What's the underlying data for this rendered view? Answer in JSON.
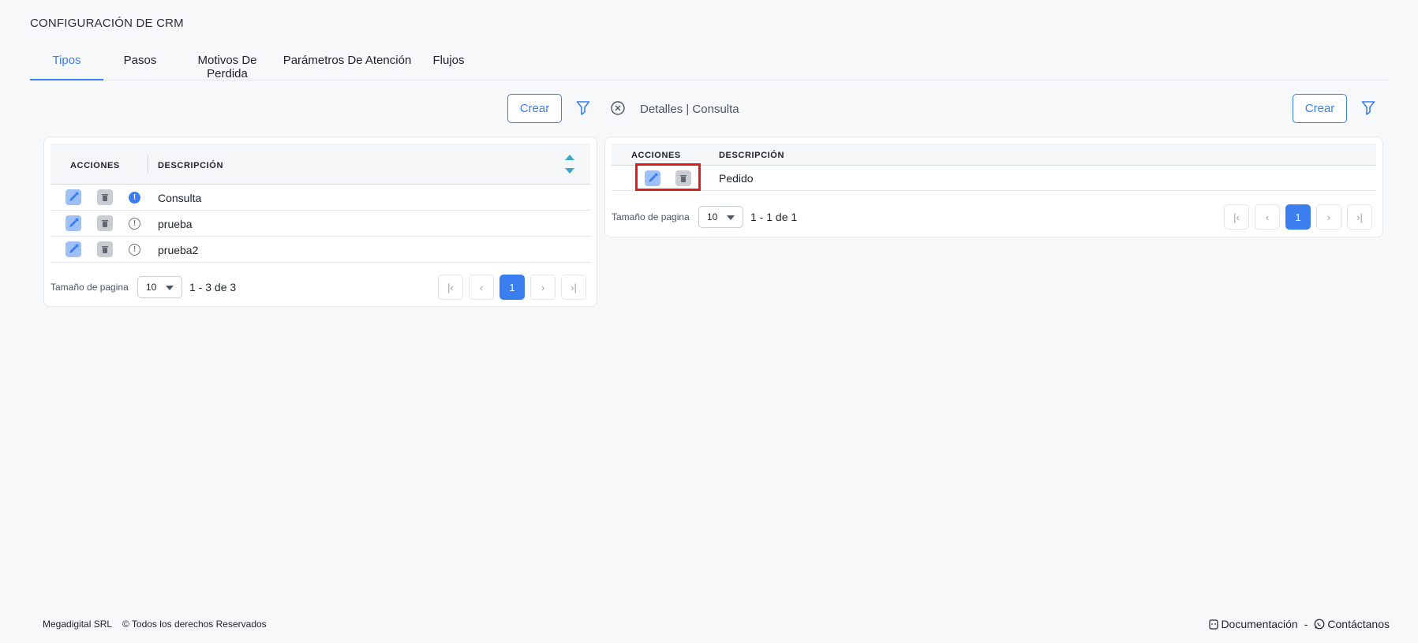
{
  "page": {
    "title": "CONFIGURACIÓN DE CRM"
  },
  "tabs": [
    {
      "label": "Tipos",
      "active": true
    },
    {
      "label": "Pasos",
      "active": false
    },
    {
      "label": "Motivos De Perdida",
      "active": false
    },
    {
      "label": "Parámetros De Atención",
      "active": false
    },
    {
      "label": "Flujos",
      "active": false
    }
  ],
  "left_panel": {
    "create_label": "Crear",
    "headers": {
      "actions": "ACCIONES",
      "description": "DESCRIPCIÓN"
    },
    "rows": [
      {
        "description": "Consulta",
        "selected": true
      },
      {
        "description": "prueba",
        "selected": false
      },
      {
        "description": "prueba2",
        "selected": false
      }
    ],
    "pagination": {
      "size_label": "Tamaño de pagina",
      "page_size": "10",
      "range": "1 - 3 de 3",
      "current_page": "1"
    }
  },
  "right_panel": {
    "details_label": "Detalles | Consulta",
    "create_label": "Crear",
    "headers": {
      "actions": "ACCIONES",
      "description": "DESCRIPCIÓN"
    },
    "rows": [
      {
        "description": "Pedido"
      }
    ],
    "pagination": {
      "size_label": "Tamaño de pagina",
      "page_size": "10",
      "range": "1 - 1 de 1",
      "current_page": "1"
    }
  },
  "footer": {
    "company": "Megadigital SRL",
    "rights": "© Todos los derechos Reservados",
    "documentation": "Documentación",
    "separator": "-",
    "contact": "Contáctanos"
  },
  "colors": {
    "accent": "#3b7ef0",
    "highlight": "#e01c1c",
    "teal": "#3aa7c7"
  },
  "icons": [
    "filter-icon",
    "close-circle-icon",
    "edit-icon",
    "trash-icon",
    "info-icon",
    "sort-icon",
    "document-icon",
    "whatsapp-icon"
  ]
}
